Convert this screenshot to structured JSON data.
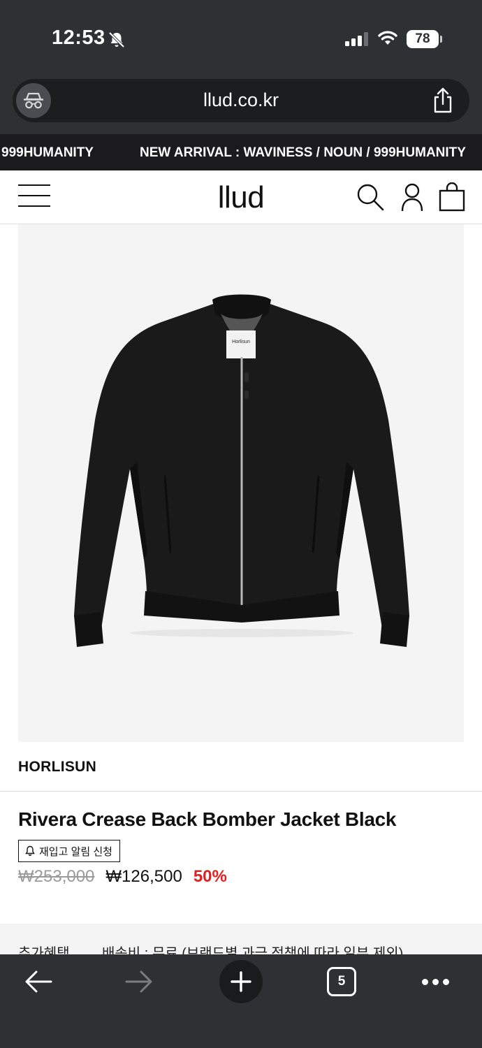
{
  "status_bar": {
    "time": "12:53",
    "battery": "78",
    "icons": [
      "bell-slash-icon",
      "cellular-signal-icon",
      "wifi-icon",
      "battery-icon"
    ]
  },
  "browser": {
    "url": "llud.co.kr",
    "incognito_icon": "incognito-icon",
    "share_icon": "share-icon",
    "tab_count": "5",
    "toolbar_icons": [
      "back-arrow-icon",
      "forward-arrow-icon",
      "plus-icon",
      "tabs-icon",
      "more-icon"
    ]
  },
  "banner": {
    "segment_a": "999HUMANITY",
    "segment_b": "NEW ARRIVAL : WAVINESS / NOUN / 999HUMANITY"
  },
  "header": {
    "logo": "llud",
    "icons": [
      "menu-icon",
      "search-icon",
      "user-icon",
      "shopping-bag-icon"
    ]
  },
  "product": {
    "brand": "HORLISUN",
    "title": "Rivera Crease Back Bomber Jacket Black",
    "restock_label": "재입고 알림 신청",
    "price_original": "₩253,000",
    "price_sale": "₩126,500",
    "discount": "50%",
    "image_tag_text": "Horlisun",
    "extra_label": "추가혜택",
    "extra_value": "배송비 : 무료 (브랜드별 과금 정책에 따라 일부 제외)"
  },
  "colors": {
    "chrome_bg": "#2e3034",
    "address_bg": "#1c1d20",
    "banner_bg": "#1b1b1d",
    "discount_red": "#e02020",
    "image_bg": "#f4f4f4",
    "jacket": "#1a1a1a"
  }
}
